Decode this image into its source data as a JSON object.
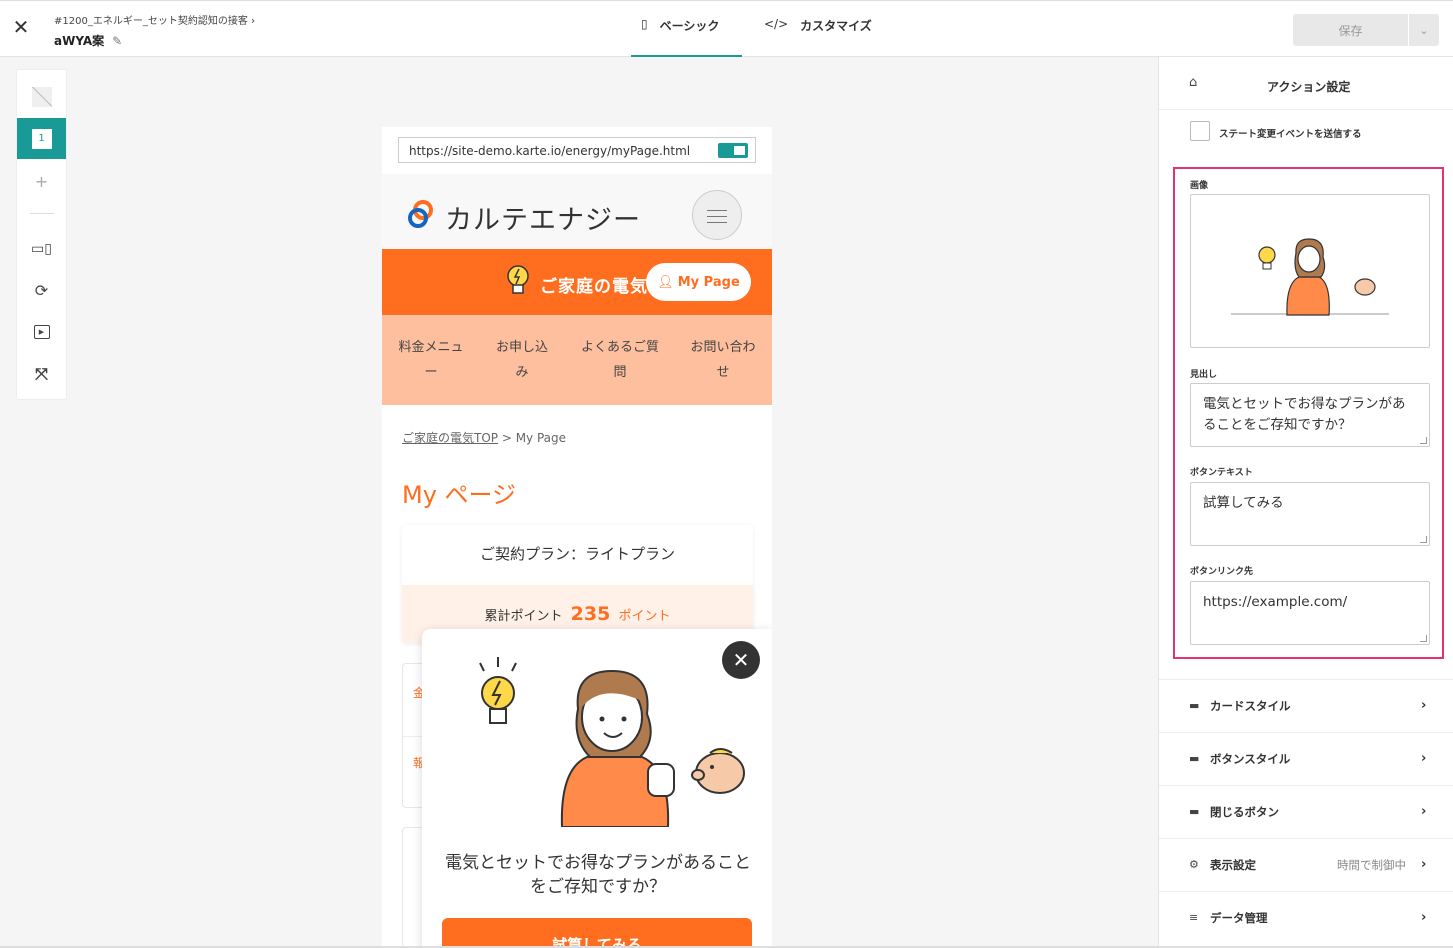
{
  "header": {
    "breadcrumb": "#1200_エネルギー_セット契約認知の接客",
    "variant_name": "aWYA案",
    "tabs": [
      {
        "label": "ベーシック",
        "icon": "panel-icon",
        "active": true
      },
      {
        "label": "カスタマイズ",
        "icon": "code-icon",
        "active": false
      }
    ],
    "save_label": "保存"
  },
  "preview": {
    "url": "https://site-demo.karte.io/energy/myPage.html",
    "logo_text": "カルテエナジー",
    "banner_text": "ご家庭の電気",
    "mypage_label": "My Page",
    "nav": [
      "料金メニュー",
      "お申し込み",
      "よくあるご質問",
      "お問い合わせ"
    ],
    "breadcrumb_link": "ご家庭の電気TOP",
    "breadcrumb_current": " > My Page",
    "page_title": "My ページ",
    "plan": "ご契約プラン：ライトプラン",
    "points_label": "累計ポイント",
    "points_value": "235",
    "points_unit": "ポイント",
    "side_card": [
      "金",
      "報"
    ],
    "popup": {
      "message": "電気とセットでお得なプランがあることをご存知ですか？",
      "button": "試算してみる"
    }
  },
  "panel": {
    "title": "アクション設定",
    "state_event_label": "ステート変更イベントを送信する",
    "fields": {
      "image_label": "画像",
      "heading_label": "見出し",
      "heading_value": "電気とセットでお得なプランがあることをご存知ですか？",
      "button_text_label": "ボタンテキスト",
      "button_text_value": "試算してみる",
      "button_link_label": "ボタンリンク先",
      "button_link_value": "https://example.com/"
    },
    "sections": [
      {
        "label": "カードスタイル",
        "icon": "folder-icon",
        "value": ""
      },
      {
        "label": "ボタンスタイル",
        "icon": "folder-icon",
        "value": ""
      },
      {
        "label": "閉じるボタン",
        "icon": "folder-icon",
        "value": ""
      },
      {
        "label": "表示設定",
        "icon": "gear-icon",
        "value": "時間で制御中"
      },
      {
        "label": "データ管理",
        "icon": "database-icon",
        "value": ""
      }
    ]
  },
  "colors": {
    "accent": "#1a9a96",
    "brand_orange": "#ff6d1f",
    "highlight_border": "#e6336e"
  }
}
